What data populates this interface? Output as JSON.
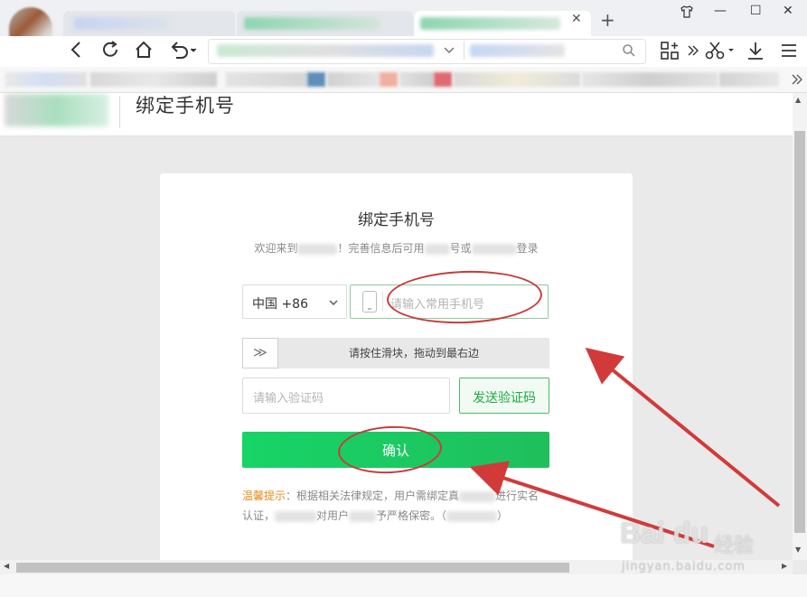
{
  "browser": {
    "new_tab_symbol": "+",
    "tab_close_symbol": "✕",
    "window_buttons": [
      "⬡",
      "—",
      "☐",
      "✕"
    ],
    "nav_icons": [
      "back-icon",
      "refresh-icon",
      "home-icon",
      "undo-icon"
    ],
    "right_icons": [
      "grid-icon",
      "more-icon",
      "scissors-icon",
      "download-icon",
      "menu-icon"
    ]
  },
  "header": {
    "title": "绑定手机号"
  },
  "form": {
    "title": "绑定手机号",
    "subtitle_part1": "欢迎来到",
    "subtitle_part2": "！完善信息后可用",
    "subtitle_part3": "号或",
    "subtitle_part4": "登录",
    "country_code": "中国 +86",
    "phone_placeholder": "请输入常用手机号",
    "slider_text": "请按住滑块，拖动到最右边",
    "slider_knob": "≫",
    "code_placeholder": "请输入验证码",
    "send_code": "发送验证码",
    "confirm": "确认",
    "tip_label": "温馨提示",
    "tip_text1": "：根据相关法律规定，用户需绑定真",
    "tip_text2": "进行实名",
    "tip_text3": "认证，",
    "tip_text4": "对用户",
    "tip_text5": "予严格保密。（",
    "tip_text6": "）"
  },
  "watermark": {
    "brand": "Bai du",
    "cn": "经验",
    "url": "jingyan.baidu.com"
  },
  "colors": {
    "accent_green": "#1fbf5c",
    "annotation_red": "#d23a3a"
  }
}
